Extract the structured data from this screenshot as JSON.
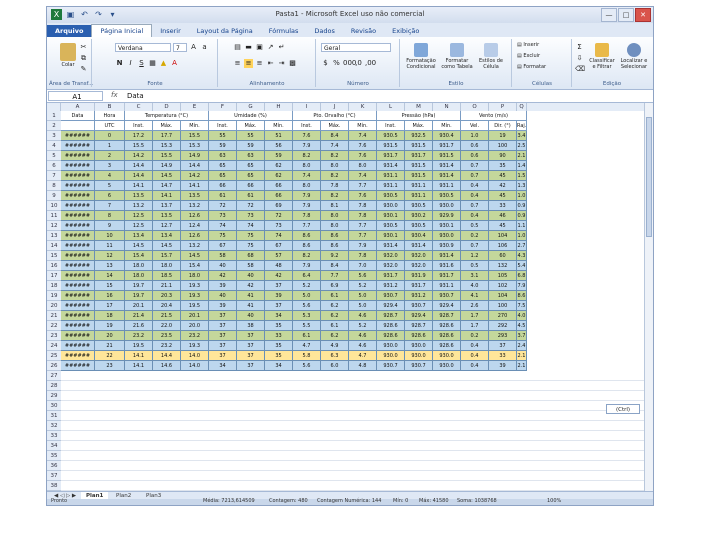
{
  "window": {
    "title": "Pasta1 - Microsoft Excel uso não comercial",
    "qat_icons": [
      "excel-icon",
      "save-icon",
      "undo-icon",
      "redo-icon",
      "customize-icon"
    ]
  },
  "ribbon_tabs": [
    "Arquivo",
    "Página Inicial",
    "Inserir",
    "Layout da Página",
    "Fórmulas",
    "Dados",
    "Revisão",
    "Exibição"
  ],
  "ribbon": {
    "clipboard": {
      "paste_label": "Colar",
      "group": "Área de Transf..."
    },
    "font": {
      "name": "Verdana",
      "size": "7",
      "group": "Fonte"
    },
    "alignment": {
      "group": "Alinhamento"
    },
    "number": {
      "format": "Geral",
      "group": "Número"
    },
    "styles": {
      "cond_label": "Formatação Condicional",
      "table_label": "Formatar como Tabela",
      "cell_label": "Estilos de Célula",
      "group": "Estilo"
    },
    "cells": {
      "insert": "Inserir",
      "delete": "Excluir",
      "format": "Formatar",
      "group": "Células"
    },
    "editing": {
      "sort_label": "Classificar e Filtrar",
      "find_label": "Localizar e Selecionar",
      "group": "Edição"
    }
  },
  "formula_bar": {
    "cell": "A1",
    "fx": "fx",
    "value": "Data"
  },
  "columns": [
    "A",
    "B",
    "C",
    "D",
    "E",
    "F",
    "G",
    "H",
    "I",
    "J",
    "K",
    "L",
    "M",
    "N",
    "O",
    "P",
    "Q"
  ],
  "header_row1": [
    "Data",
    "Hora",
    "Temperatura (°C)",
    "",
    "",
    "Umidade (%)",
    "",
    "",
    "Pto. Orvalho (°C)",
    "",
    "",
    "Pressão (hPa)",
    "",
    "",
    "Vento (m/s)",
    "",
    ""
  ],
  "header_row2": [
    "",
    "UTC",
    "Inst.",
    "Máx.",
    "Mín.",
    "Inst.",
    "Máx.",
    "Mín.",
    "Inst.",
    "Máx.",
    "Mín.",
    "Inst.",
    "Máx.",
    "Mín.",
    "Vel.",
    "Dir. (°)",
    "Raj."
  ],
  "rows": [
    {
      "style": "r-green",
      "cells": [
        "######",
        "0",
        "17.2",
        "17.7",
        "15.5",
        "55",
        "55",
        "51",
        "7.6",
        "8.4",
        "7.4",
        "930.5",
        "932.5",
        "930.4",
        "1.0",
        "19",
        "3.4"
      ]
    },
    {
      "style": "r-blue",
      "cells": [
        "######",
        "1",
        "15.5",
        "15.3",
        "15.3",
        "59",
        "59",
        "56",
        "7.9",
        "7.4",
        "7.6",
        "931.5",
        "931.5",
        "931.7",
        "0.6",
        "100",
        "2.5"
      ]
    },
    {
      "style": "r-green",
      "cells": [
        "######",
        "2",
        "14.2",
        "15.5",
        "14.9",
        "63",
        "63",
        "59",
        "8.2",
        "8.2",
        "7.6",
        "931.7",
        "931.7",
        "931.5",
        "0.6",
        "90",
        "2.1"
      ]
    },
    {
      "style": "r-blue",
      "cells": [
        "######",
        "3",
        "14.4",
        "14.9",
        "14.4",
        "65",
        "65",
        "62",
        "8.0",
        "8.0",
        "8.0",
        "931.4",
        "931.5",
        "931.4",
        "0.7",
        "35",
        "1.4"
      ]
    },
    {
      "style": "r-green",
      "cells": [
        "######",
        "4",
        "14.4",
        "14.5",
        "14.2",
        "65",
        "65",
        "62",
        "7.4",
        "8.2",
        "7.4",
        "931.1",
        "931.5",
        "931.4",
        "0.7",
        "45",
        "1.5"
      ]
    },
    {
      "style": "r-blue",
      "cells": [
        "######",
        "5",
        "14.1",
        "14.7",
        "14.1",
        "66",
        "66",
        "66",
        "8.0",
        "7.8",
        "7.7",
        "931.1",
        "931.1",
        "931.1",
        "0.4",
        "42",
        "1.3"
      ]
    },
    {
      "style": "r-green",
      "cells": [
        "######",
        "6",
        "13.5",
        "14.1",
        "13.5",
        "61",
        "61",
        "66",
        "7.9",
        "8.2",
        "7.6",
        "930.5",
        "931.1",
        "930.5",
        "0.4",
        "45",
        "1.0"
      ]
    },
    {
      "style": "r-blue",
      "cells": [
        "######",
        "7",
        "13.2",
        "13.7",
        "13.2",
        "72",
        "72",
        "69",
        "7.9",
        "8.1",
        "7.8",
        "930.0",
        "930.5",
        "930.0",
        "0.7",
        "33",
        "0.9"
      ]
    },
    {
      "style": "r-green",
      "cells": [
        "######",
        "8",
        "12.5",
        "13.5",
        "12.6",
        "73",
        "73",
        "72",
        "7.8",
        "8.0",
        "7.8",
        "930.1",
        "930.2",
        "929.9",
        "0.4",
        "46",
        "0.9"
      ]
    },
    {
      "style": "r-blue",
      "cells": [
        "######",
        "9",
        "12.5",
        "12.7",
        "12.4",
        "74",
        "74",
        "73",
        "7.7",
        "8.0",
        "7.7",
        "930.5",
        "930.5",
        "930.1",
        "0.5",
        "45",
        "1.1"
      ]
    },
    {
      "style": "r-green",
      "cells": [
        "######",
        "10",
        "13.4",
        "13.4",
        "12.6",
        "75",
        "75",
        "74",
        "8.6",
        "8.6",
        "7.7",
        "930.1",
        "930.4",
        "930.0",
        "0.2",
        "104",
        "1.0"
      ]
    },
    {
      "style": "r-blue",
      "cells": [
        "######",
        "11",
        "14.5",
        "14.5",
        "13.2",
        "67",
        "75",
        "67",
        "8.6",
        "8.6",
        "7.9",
        "931.4",
        "931.4",
        "930.9",
        "0.7",
        "106",
        "2.7"
      ]
    },
    {
      "style": "r-green",
      "cells": [
        "######",
        "12",
        "15.4",
        "15.7",
        "14.5",
        "58",
        "68",
        "57",
        "8.2",
        "9.2",
        "7.8",
        "932.0",
        "932.0",
        "931.4",
        "1.2",
        "60",
        "4.3"
      ]
    },
    {
      "style": "r-blue",
      "cells": [
        "######",
        "13",
        "18.0",
        "18.0",
        "15.4",
        "40",
        "58",
        "48",
        "7.9",
        "8.4",
        "7.0",
        "932.0",
        "932.0",
        "931.6",
        "0.5",
        "132",
        "5.4"
      ]
    },
    {
      "style": "r-green",
      "cells": [
        "######",
        "14",
        "18.0",
        "18.5",
        "18.0",
        "42",
        "40",
        "42",
        "6.4",
        "7.7",
        "5.6",
        "931.7",
        "931.9",
        "931.7",
        "3.1",
        "105",
        "6.8"
      ]
    },
    {
      "style": "r-blue",
      "cells": [
        "######",
        "15",
        "19.7",
        "21.1",
        "19.3",
        "39",
        "42",
        "37",
        "5.2",
        "6.9",
        "5.2",
        "931.2",
        "931.7",
        "931.1",
        "4.0",
        "102",
        "7.9"
      ]
    },
    {
      "style": "r-green",
      "cells": [
        "######",
        "16",
        "19.7",
        "20.3",
        "19.3",
        "40",
        "41",
        "39",
        "5.0",
        "6.1",
        "5.0",
        "930.7",
        "931.2",
        "930.7",
        "4.1",
        "104",
        "8.6"
      ]
    },
    {
      "style": "r-blue",
      "cells": [
        "######",
        "17",
        "20.1",
        "20.4",
        "19.5",
        "39",
        "41",
        "37",
        "5.6",
        "6.2",
        "5.0",
        "929.4",
        "930.7",
        "929.4",
        "2.6",
        "100",
        "7.5"
      ]
    },
    {
      "style": "r-green",
      "cells": [
        "######",
        "18",
        "21.4",
        "21.5",
        "20.1",
        "37",
        "40",
        "34",
        "5.3",
        "6.2",
        "4.6",
        "928.7",
        "929.4",
        "928.7",
        "1.7",
        "270",
        "4.0"
      ]
    },
    {
      "style": "r-blue",
      "cells": [
        "######",
        "19",
        "21.6",
        "22.0",
        "20.0",
        "37",
        "38",
        "35",
        "5.5",
        "6.1",
        "5.2",
        "928.6",
        "928.7",
        "928.6",
        "1.7",
        "292",
        "4.5"
      ]
    },
    {
      "style": "r-green",
      "cells": [
        "######",
        "20",
        "23.2",
        "23.5",
        "23.2",
        "37",
        "37",
        "33",
        "6.1",
        "6.2",
        "4.6",
        "928.6",
        "928.6",
        "928.6",
        "0.2",
        "293",
        "3.7"
      ]
    },
    {
      "style": "r-blue",
      "cells": [
        "######",
        "21",
        "19.5",
        "23.2",
        "19.3",
        "37",
        "37",
        "35",
        "4.7",
        "4.9",
        "4.6",
        "930.0",
        "930.0",
        "928.6",
        "0.4",
        "37",
        "2.4"
      ]
    },
    {
      "style": "r-yellow",
      "cells": [
        "######",
        "22",
        "14.1",
        "14.4",
        "14.0",
        "37",
        "37",
        "35",
        "5.8",
        "6.3",
        "4.7",
        "930.0",
        "930.0",
        "930.0",
        "0.4",
        "33",
        "2.1"
      ]
    },
    {
      "style": "r-blue",
      "cells": [
        "######",
        "23",
        "14.1",
        "14.6",
        "14.0",
        "34",
        "37",
        "34",
        "5.6",
        "6.0",
        "4.8",
        "930.7",
        "930.7",
        "930.0",
        "0.4",
        "39",
        "2.1"
      ]
    }
  ],
  "row_numbers": [
    "1",
    "2",
    "3",
    "4",
    "5",
    "6",
    "7",
    "8",
    "9",
    "10",
    "11",
    "12",
    "13",
    "14",
    "15",
    "16",
    "17",
    "18",
    "19",
    "20",
    "21",
    "22",
    "23",
    "24",
    "25",
    "26",
    "27",
    "28",
    "29",
    "30",
    "31",
    "32",
    "33",
    "34",
    "35",
    "36",
    "37",
    "38"
  ],
  "paste_options": "(Ctrl)",
  "sheet_tabs": [
    "Plan1",
    "Plan2",
    "Plan3"
  ],
  "status": {
    "mode": "Pronto",
    "media": "Média: 7213,614509",
    "contagem": "Contagem: 480",
    "contagem_num": "Contagem Numérica: 144",
    "min": "Mín: 0",
    "max": "Máx: 41580",
    "soma": "Soma: 1038768",
    "zoom": "100%"
  },
  "colors": {
    "green_row": "#c4d79b",
    "blue_row": "#bdd7ee",
    "yellow_row": "#ffe699",
    "file_tab": "#2a5fb0"
  }
}
